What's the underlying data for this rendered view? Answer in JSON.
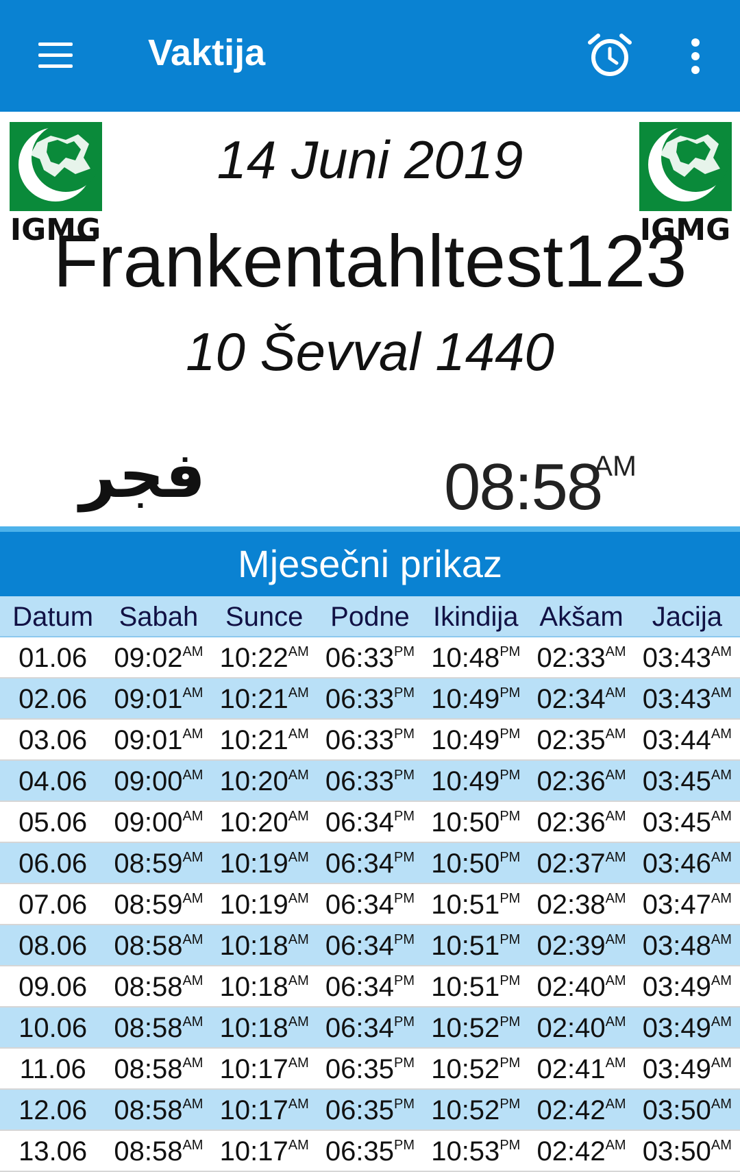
{
  "appbar": {
    "title": "Vaktija",
    "icons": {
      "menu": "menu-icon",
      "alarm": "alarm-clock-icon",
      "more": "more-vert-icon"
    },
    "color": "#0a82d2"
  },
  "logo": {
    "text": "IGMG",
    "brand_color": "#0a8a3a"
  },
  "header": {
    "gregorian_date": "14 Juni 2019",
    "city": "Frankentahltest123",
    "hijri_date": "10 Ševval 1440"
  },
  "next_prayer": {
    "arabic_name": "فجر",
    "time": "08:58",
    "ampm": "AM"
  },
  "monthly": {
    "title": "Mjesečni prikaz",
    "columns": [
      "Datum",
      "Sabah",
      "Sunce",
      "Podne",
      "Ikindija",
      "Akšam",
      "Jacija"
    ],
    "rows": [
      {
        "date": "01.06",
        "times": [
          [
            "09:02",
            "AM"
          ],
          [
            "10:22",
            "AM"
          ],
          [
            "06:33",
            "PM"
          ],
          [
            "10:48",
            "PM"
          ],
          [
            "02:33",
            "AM"
          ],
          [
            "03:43",
            "AM"
          ]
        ]
      },
      {
        "date": "02.06",
        "times": [
          [
            "09:01",
            "AM"
          ],
          [
            "10:21",
            "AM"
          ],
          [
            "06:33",
            "PM"
          ],
          [
            "10:49",
            "PM"
          ],
          [
            "02:34",
            "AM"
          ],
          [
            "03:43",
            "AM"
          ]
        ]
      },
      {
        "date": "03.06",
        "times": [
          [
            "09:01",
            "AM"
          ],
          [
            "10:21",
            "AM"
          ],
          [
            "06:33",
            "PM"
          ],
          [
            "10:49",
            "PM"
          ],
          [
            "02:35",
            "AM"
          ],
          [
            "03:44",
            "AM"
          ]
        ]
      },
      {
        "date": "04.06",
        "times": [
          [
            "09:00",
            "AM"
          ],
          [
            "10:20",
            "AM"
          ],
          [
            "06:33",
            "PM"
          ],
          [
            "10:49",
            "PM"
          ],
          [
            "02:36",
            "AM"
          ],
          [
            "03:45",
            "AM"
          ]
        ]
      },
      {
        "date": "05.06",
        "times": [
          [
            "09:00",
            "AM"
          ],
          [
            "10:20",
            "AM"
          ],
          [
            "06:34",
            "PM"
          ],
          [
            "10:50",
            "PM"
          ],
          [
            "02:36",
            "AM"
          ],
          [
            "03:45",
            "AM"
          ]
        ]
      },
      {
        "date": "06.06",
        "times": [
          [
            "08:59",
            "AM"
          ],
          [
            "10:19",
            "AM"
          ],
          [
            "06:34",
            "PM"
          ],
          [
            "10:50",
            "PM"
          ],
          [
            "02:37",
            "AM"
          ],
          [
            "03:46",
            "AM"
          ]
        ]
      },
      {
        "date": "07.06",
        "times": [
          [
            "08:59",
            "AM"
          ],
          [
            "10:19",
            "AM"
          ],
          [
            "06:34",
            "PM"
          ],
          [
            "10:51",
            "PM"
          ],
          [
            "02:38",
            "AM"
          ],
          [
            "03:47",
            "AM"
          ]
        ]
      },
      {
        "date": "08.06",
        "times": [
          [
            "08:58",
            "AM"
          ],
          [
            "10:18",
            "AM"
          ],
          [
            "06:34",
            "PM"
          ],
          [
            "10:51",
            "PM"
          ],
          [
            "02:39",
            "AM"
          ],
          [
            "03:48",
            "AM"
          ]
        ]
      },
      {
        "date": "09.06",
        "times": [
          [
            "08:58",
            "AM"
          ],
          [
            "10:18",
            "AM"
          ],
          [
            "06:34",
            "PM"
          ],
          [
            "10:51",
            "PM"
          ],
          [
            "02:40",
            "AM"
          ],
          [
            "03:49",
            "AM"
          ]
        ]
      },
      {
        "date": "10.06",
        "times": [
          [
            "08:58",
            "AM"
          ],
          [
            "10:18",
            "AM"
          ],
          [
            "06:34",
            "PM"
          ],
          [
            "10:52",
            "PM"
          ],
          [
            "02:40",
            "AM"
          ],
          [
            "03:49",
            "AM"
          ]
        ]
      },
      {
        "date": "11.06",
        "times": [
          [
            "08:58",
            "AM"
          ],
          [
            "10:17",
            "AM"
          ],
          [
            "06:35",
            "PM"
          ],
          [
            "10:52",
            "PM"
          ],
          [
            "02:41",
            "AM"
          ],
          [
            "03:49",
            "AM"
          ]
        ]
      },
      {
        "date": "12.06",
        "times": [
          [
            "08:58",
            "AM"
          ],
          [
            "10:17",
            "AM"
          ],
          [
            "06:35",
            "PM"
          ],
          [
            "10:52",
            "PM"
          ],
          [
            "02:42",
            "AM"
          ],
          [
            "03:50",
            "AM"
          ]
        ]
      },
      {
        "date": "13.06",
        "times": [
          [
            "08:58",
            "AM"
          ],
          [
            "10:17",
            "AM"
          ],
          [
            "06:35",
            "PM"
          ],
          [
            "10:53",
            "PM"
          ],
          [
            "02:42",
            "AM"
          ],
          [
            "03:50",
            "AM"
          ]
        ]
      }
    ]
  }
}
